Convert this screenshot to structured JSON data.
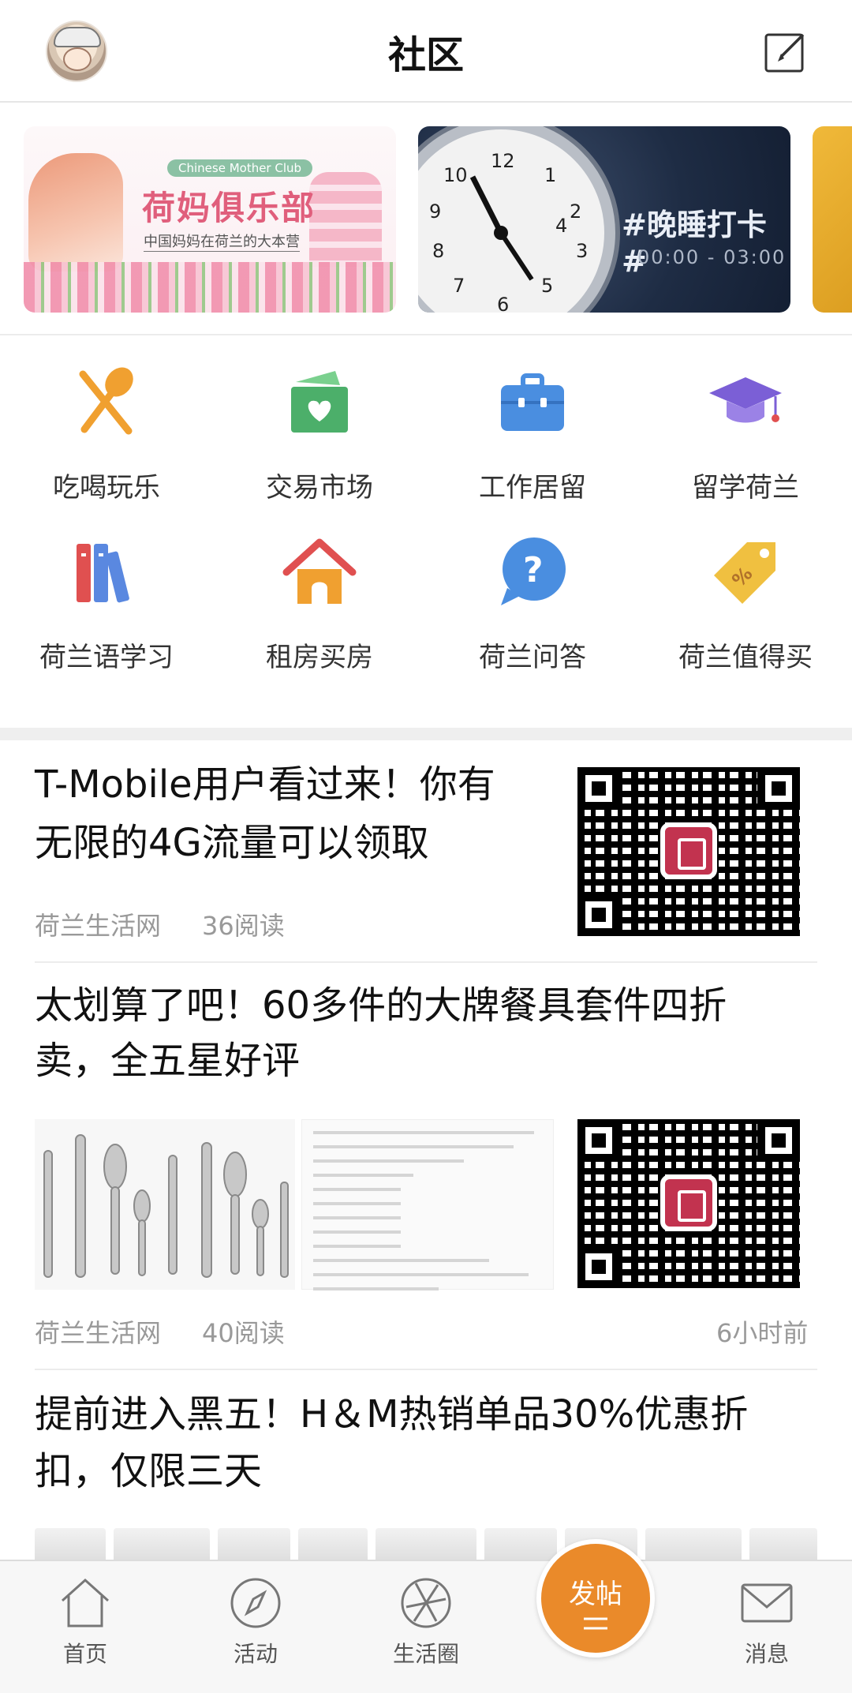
{
  "header": {
    "title": "社区"
  },
  "banners": [
    {
      "tag": "Chinese Mother Club",
      "title": "荷妈俱乐部",
      "subtitle": "中国妈妈在荷兰的大本营"
    },
    {
      "title": "#晚睡打卡#",
      "time": "00:00 - 03:00"
    }
  ],
  "categories": [
    {
      "label": "吃喝玩乐",
      "icon": "utensils-icon",
      "color": "#f0a030"
    },
    {
      "label": "交易市场",
      "icon": "shopping-basket-icon",
      "color": "#4caf6a"
    },
    {
      "label": "工作居留",
      "icon": "briefcase-icon",
      "color": "#4a8ee0"
    },
    {
      "label": "留学荷兰",
      "icon": "graduation-cap-icon",
      "color": "#7b5fd6"
    },
    {
      "label": "荷兰语学习",
      "icon": "books-icon",
      "color": "#e05050"
    },
    {
      "label": "租房买房",
      "icon": "house-icon",
      "color": "#f0a030"
    },
    {
      "label": "荷兰问答",
      "icon": "question-bubble-icon",
      "color": "#4a8ee0"
    },
    {
      "label": "荷兰值得买",
      "icon": "discount-tag-icon",
      "color": "#f0c040"
    }
  ],
  "feed": [
    {
      "title_line1": "T-Mobile用户看过来！你有",
      "title_line2": "无限的4G流量可以领取",
      "source": "荷兰生活网",
      "reads": "36阅读"
    },
    {
      "title_line1": "太划算了吧！60多件的大牌餐具套件四折",
      "title_line2": "卖，全五星好评",
      "source": "荷兰生活网",
      "reads": "40阅读",
      "time": "6小时前"
    },
    {
      "title_line1": "提前进入黑五！H＆M热销单品30%优惠折",
      "title_line2": "扣，仅限三天"
    }
  ],
  "tabbar": {
    "home": "首页",
    "activity": "活动",
    "life_circle": "生活圈",
    "post": "发帖",
    "messages": "消息"
  },
  "colors": {
    "accent": "#ea8a2a",
    "text": "#111111",
    "meta": "#999999"
  }
}
